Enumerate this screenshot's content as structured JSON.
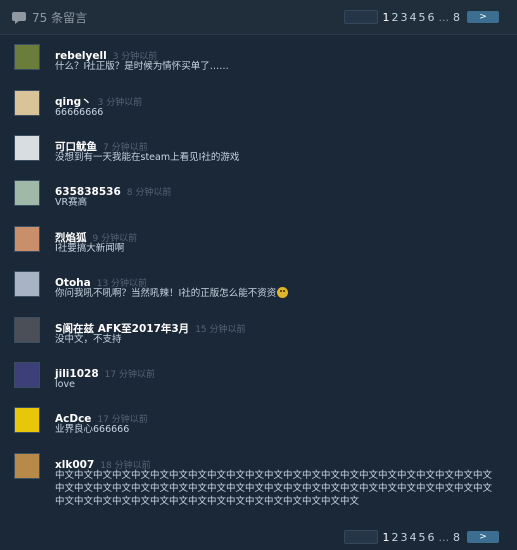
{
  "header": {
    "title": "75 条留言",
    "pages": [
      "1",
      "2",
      "3",
      "4",
      "5",
      "6"
    ],
    "ellipsis": "...",
    "last_page": "8",
    "next_label": ">"
  },
  "comments": [
    {
      "author": "rebelyell",
      "time": "3 分钟以前",
      "text": "什么？I社正版？是时候为情怀买单了……",
      "avatar_color": "#6b7d3a",
      "avatar_icon": "dog-avatar"
    },
    {
      "author": "qing丶",
      "time": "3 分钟以前",
      "text": "66666666",
      "avatar_color": "#d9c49a",
      "avatar_icon": "character-avatar"
    },
    {
      "author": "可口鱿鱼",
      "time": "7 分钟以前",
      "text": "没想到有一天我能在steam上看见I社的游戏",
      "avatar_color": "#d8dde2",
      "avatar_icon": "bunny-avatar"
    },
    {
      "author": "635838536",
      "time": "8 分钟以前",
      "text": "VR赛高",
      "avatar_color": "#9fb8a8",
      "avatar_icon": "anime-avatar"
    },
    {
      "author": "烈焰狐",
      "time": "9 分钟以前",
      "text": "I社要搞大新闻啊",
      "avatar_color": "#c98f6b",
      "avatar_icon": "anime-girl-avatar"
    },
    {
      "author": "Otoha",
      "time": "13 分钟以前",
      "text": "你问我吼不吼啊？当然吼辣！I社的正版怎么能不资资",
      "avatar_color": "#a8b4c4",
      "avatar_icon": "anime-avatar-2"
    },
    {
      "author": "S阆在兹 AFK至2017年3月",
      "time": "15 分钟以前",
      "text": "没中文，不支持",
      "avatar_color": "#4a4f58",
      "avatar_icon": "man-avatar"
    },
    {
      "author": "jili1028",
      "time": "17 分钟以前",
      "text": "love",
      "avatar_color": "#3c3f78",
      "avatar_icon": "dark-avatar"
    },
    {
      "author": "AcDce",
      "time": "17 分钟以前",
      "text": "业界良心666666",
      "avatar_color": "#e8c60a",
      "avatar_icon": "yellow-avatar"
    },
    {
      "author": "xlk007",
      "time": "18 分钟以前",
      "text": "中文中文中文中文中文中文中文中文中文中文中文中文中文中文中文中文中文中文中文中文中文中文中文中文中文中文中文中文中文中文中文中文中文中文中文中文中文中文中文中文中文中文中文中文中文中文中文中文中文中文中文中文中文中文中文中文中文中文中文中文中文中文",
      "avatar_color": "#b88a4a",
      "avatar_icon": "shiba-avatar"
    }
  ]
}
